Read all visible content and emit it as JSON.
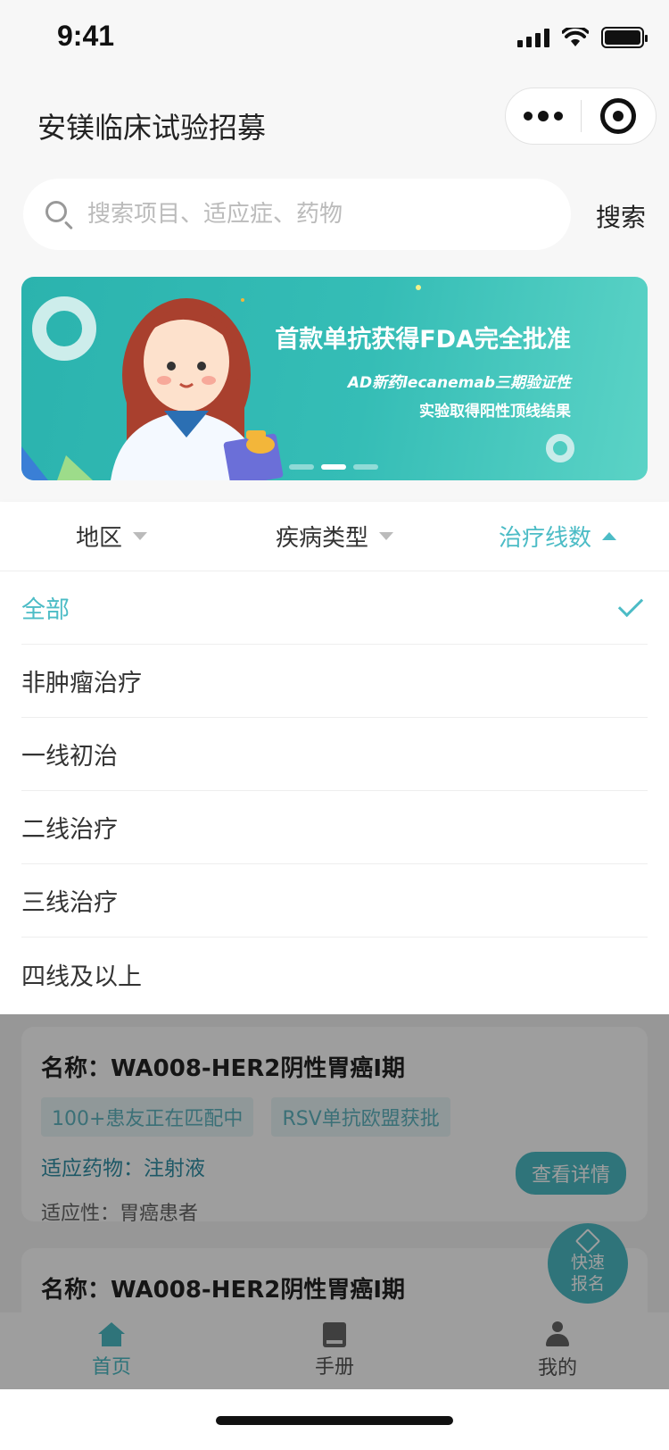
{
  "status_bar": {
    "time": "9:41"
  },
  "nav": {
    "title": "安镁临床试验招募"
  },
  "search": {
    "placeholder": "搜索项目、适应症、药物",
    "button_label": "搜索"
  },
  "banner": {
    "title": "首款单抗获得FDA完全批准",
    "subtitle_line1": "AD新药lecanemab三期验证性",
    "subtitle_line2": "实验取得阳性顶线结果",
    "active_slide_index": 1,
    "slide_count": 3
  },
  "filters": [
    {
      "label": "地区",
      "active": false
    },
    {
      "label": "疾病类型",
      "active": false
    },
    {
      "label": "治疗线数",
      "active": true
    }
  ],
  "dropdown": {
    "options": [
      "全部",
      "非肿瘤治疗",
      "一线初治",
      "二线治疗",
      "三线治疗",
      "四线及以上"
    ],
    "selected": "全部"
  },
  "cards": [
    {
      "title": "名称：WA008-HER2阴性胃癌I期",
      "tags": [
        "100+患友正在匹配中",
        "RSV单抗欧盟获批"
      ],
      "drug": "适应药物：注射液",
      "adaptation": "适应性：胃癌患者",
      "button_label": "查看详情"
    },
    {
      "title": "名称：WA008-HER2阴性胃癌I期"
    }
  ],
  "quick_signup": {
    "line1": "快速",
    "line2": "报名"
  },
  "tab_bar": [
    {
      "label": "首页",
      "icon": "home-icon",
      "active": true
    },
    {
      "label": "手册",
      "icon": "book-icon",
      "active": false
    },
    {
      "label": "我的",
      "icon": "user-icon",
      "active": false
    }
  ],
  "colors": {
    "accent": "#4cbcc6",
    "banner": "#35bdb6"
  }
}
